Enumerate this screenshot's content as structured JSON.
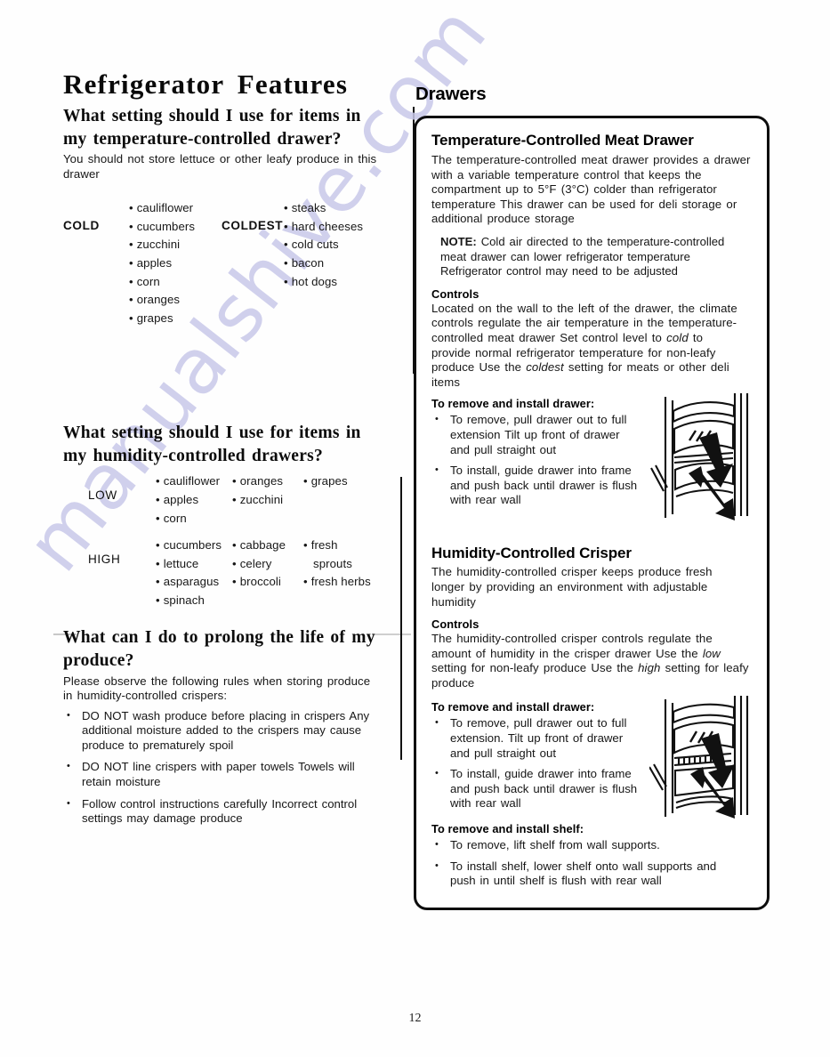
{
  "page": {
    "title": "Refrigerator Features",
    "page_number": "12",
    "watermark": "manualshive.com",
    "watermark_color": "#c9c9ea"
  },
  "left": {
    "temp_question": {
      "heading_line1": "What setting should I use for items in",
      "heading_line2": "my temperature-controlled drawer?",
      "intro": "You should not store lettuce or other leafy produce in this drawer",
      "cold_label": "COLD",
      "cold_items": [
        "cauliflower",
        "cucumbers",
        "zucchini",
        "apples",
        "corn",
        "oranges",
        "grapes"
      ],
      "coldest_label": "COLDEST",
      "coldest_items": [
        "steaks",
        "hard cheeses",
        "cold cuts",
        "bacon",
        "hot dogs"
      ]
    },
    "humidity_question": {
      "heading_line1": "What setting should I use for items in",
      "heading_line2": "my humidity-controlled drawers?",
      "low_label": "LOW",
      "low_col1": [
        "cauliflower",
        "apples",
        "corn"
      ],
      "low_col2": [
        "oranges",
        "zucchini"
      ],
      "low_col3": [
        "grapes"
      ],
      "high_label": "HIGH",
      "high_col1": [
        "cucumbers",
        "lettuce",
        "asparagus",
        "spinach"
      ],
      "high_col2": [
        "cabbage",
        "celery",
        "broccoli"
      ],
      "high_col3": [
        "fresh",
        "sprouts",
        "fresh herbs"
      ]
    },
    "prolong_question": {
      "heading_line1": "What can I do to prolong the life of my",
      "heading_line2": "produce?",
      "intro": "Please observe the following rules when storing produce in humidity-controlled crispers:",
      "bullets": [
        "DO NOT wash produce before placing in crispers Any additional moisture added to the crispers may cause produce to prematurely spoil",
        "DO NOT line crispers with paper towels Towels will retain moisture",
        "Follow control instructions carefully Incorrect control settings may damage produce"
      ]
    }
  },
  "right": {
    "section_heading": "Drawers",
    "meat_drawer": {
      "heading": "Temperature-Controlled Meat Drawer",
      "intro": "The temperature-controlled meat drawer provides a drawer with a variable temperature control that keeps the compartment up to 5°F (3°C) colder than refrigerator temperature This drawer can be used for deli storage or additional produce storage",
      "note_label": "NOTE:",
      "note_text": "Cold air directed to the temperature-controlled meat drawer can lower refrigerator temperature Refrigerator control may need to be adjusted",
      "controls_label": "Controls",
      "controls_text_1": "Located on the wall to the left of the drawer, the climate controls regulate the air temperature in the temperature-controlled meat drawer Set control level to ",
      "controls_em_1": "cold",
      "controls_text_2": " to provide normal refrigerator temperature for non-leafy produce Use the ",
      "controls_em_2": "coldest",
      "controls_text_3": " setting for meats or other deli items",
      "remove_label": "To remove and install drawer:",
      "remove_bullets": [
        "To remove, pull drawer out to full extension Tilt up front of drawer and pull straight out",
        "To install, guide drawer into frame and push back until drawer is flush with rear wall"
      ]
    },
    "crisper": {
      "heading": "Humidity-Controlled Crisper",
      "intro": "The humidity-controlled crisper keeps produce fresh longer by providing an environment with adjustable humidity",
      "controls_label": "Controls",
      "controls_text_1": "The humidity-controlled crisper controls regulate the amount of humidity in the crisper drawer Use the ",
      "controls_em_1": "low",
      "controls_text_2": " setting for non-leafy produce Use the ",
      "controls_em_2": "high",
      "controls_text_3": " setting for leafy produce",
      "remove_drawer_label": "To remove and install drawer:",
      "remove_drawer_bullets": [
        "To remove, pull drawer out to full extension. Tilt up front of drawer and pull straight out",
        "To install, guide drawer into frame and push back until drawer is flush with rear wall"
      ],
      "remove_shelf_label": "To remove and install shelf:",
      "remove_shelf_bullets": [
        "To remove, lift shelf from wall supports.",
        "To install shelf, lower shelf onto wall supports and push in until shelf is flush with rear wall"
      ]
    },
    "figure_alt_meat": "refrigerator-drawer-removal-diagram",
    "figure_alt_crisper": "crisper-drawer-removal-diagram"
  }
}
